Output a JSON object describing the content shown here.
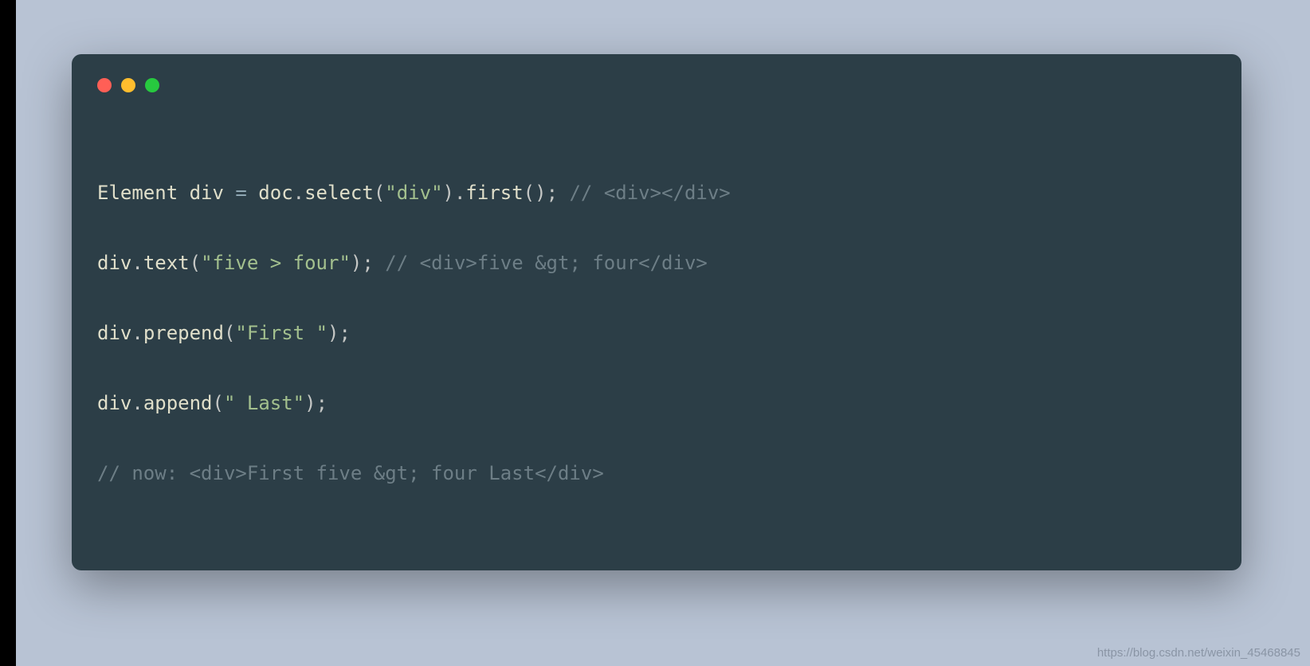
{
  "window": {
    "dots": [
      "red",
      "yellow",
      "green"
    ]
  },
  "code": {
    "line1": {
      "t1": "Element div ",
      "op": "= ",
      "t2": "doc",
      "p1": ".",
      "m1": "select",
      "p2": "(",
      "s1": "\"div\"",
      "p3": ").",
      "m2": "first",
      "p4": "(); ",
      "c1": "// <div></div>"
    },
    "line2": {
      "t1": "div",
      "p1": ".",
      "m1": "text",
      "p2": "(",
      "s1": "\"five > four\"",
      "p3": "); ",
      "c1": "// <div>five &gt; four</div>"
    },
    "line3": {
      "t1": "div",
      "p1": ".",
      "m1": "prepend",
      "p2": "(",
      "s1": "\"First \"",
      "p3": ");"
    },
    "line4": {
      "t1": "div",
      "p1": ".",
      "m1": "append",
      "p2": "(",
      "s1": "\" Last\"",
      "p3": ");"
    },
    "line5": {
      "c1": "// now: <div>First five &gt; four Last</div>"
    }
  },
  "watermark": "https://blog.csdn.net/weixin_45468845"
}
